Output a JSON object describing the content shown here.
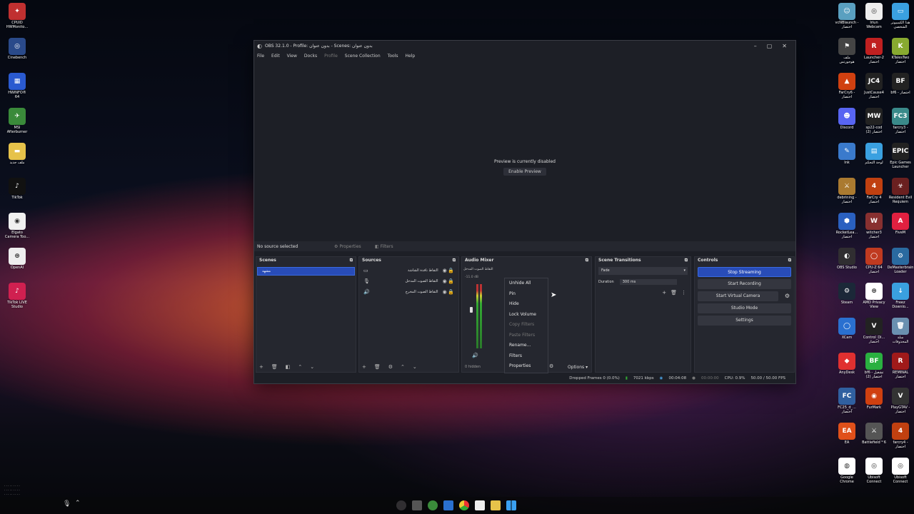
{
  "desktop_left": [
    {
      "label": "CPUID\nHWMonito...",
      "color": "#c03030",
      "glyph": "✦",
      "icon": "hwmonitor-icon"
    },
    {
      "label": "Cinebench",
      "color": "#2a4a8a",
      "glyph": "◎",
      "icon": "cinebench-icon"
    },
    {
      "label": "HWiNFO®\n64",
      "color": "#2a5ad0",
      "glyph": "▦",
      "icon": "hwinfo-icon"
    },
    {
      "label": "MSI\nAfterburner",
      "color": "#3a8a3a",
      "glyph": "✈",
      "icon": "afterburner-icon"
    },
    {
      "label": "ملف جديد",
      "color": "#e6c24a",
      "glyph": "▬",
      "icon": "folder-icon"
    },
    {
      "label": "TikTok",
      "color": "#111111",
      "glyph": "♪",
      "icon": "tiktok-icon"
    },
    {
      "label": "Elgato\nCamera Too...",
      "color": "#f0f0f0",
      "glyph": "◉",
      "icon": "elgato-icon"
    },
    {
      "label": "OpenAI",
      "color": "#eeeeee",
      "glyph": "⊛",
      "icon": "openai-icon"
    },
    {
      "label": "TikTok LIVE\nStudio",
      "color": "#d02050",
      "glyph": "♪",
      "icon": "tiktok-live-icon"
    }
  ],
  "desktop_right_col1": [
    {
      "label": "vcNBlaunch -\nاختصار",
      "color": "#5aa0c0",
      "glyph": "☺",
      "icon": "launcher-icon"
    },
    {
      "label": "ملف\nهوجورتس",
      "color": "#444444",
      "glyph": "⚑",
      "icon": "hogwarts-icon"
    },
    {
      "label": "FarCry6 -\nاختصار",
      "color": "#d04010",
      "glyph": "▲",
      "icon": "farcry6-icon"
    },
    {
      "label": "Discord",
      "color": "#5865f2",
      "glyph": "☻",
      "icon": "discord-icon"
    },
    {
      "label": "Ink",
      "color": "#3a7acc",
      "glyph": "✎",
      "icon": "ink-icon"
    },
    {
      "label": "debrining -\nاختصار",
      "color": "#aa7a30",
      "glyph": "⚔",
      "icon": "game-icon"
    },
    {
      "label": "RocketLea...\nاختصار",
      "color": "#2a60c0",
      "glyph": "⬢",
      "icon": "rocketleague-icon"
    },
    {
      "label": "OBS Studio",
      "color": "#302e31",
      "glyph": "◐",
      "icon": "obs-icon"
    },
    {
      "label": "Steam",
      "color": "#1b2838",
      "glyph": "⚙",
      "icon": "steam-icon"
    },
    {
      "label": "XCam",
      "color": "#2a70d0",
      "glyph": "◯",
      "icon": "xcam-icon"
    },
    {
      "label": "AnyDesk",
      "color": "#e03030",
      "glyph": "◆",
      "icon": "anydesk-icon"
    },
    {
      "label": "FC25_d_...\nاختصار",
      "color": "#3060a0",
      "glyph": "FC",
      "icon": "fc25-icon"
    },
    {
      "label": "EA",
      "color": "#e0501a",
      "glyph": "EA",
      "icon": "ea-icon"
    },
    {
      "label": "Google\nChrome",
      "color": "#ffffff",
      "glyph": "◍",
      "icon": "chrome-icon"
    }
  ],
  "desktop_right_col2": [
    {
      "label": "Iriun\nWebcam",
      "color": "#eeeeee",
      "glyph": "◎",
      "icon": "iriun-icon"
    },
    {
      "label": "Launcher-2\nاختصار",
      "color": "#c02020",
      "glyph": "R",
      "icon": "launcher2-icon"
    },
    {
      "label": "JustCause4\nاختصار",
      "color": "#222222",
      "glyph": "JC4",
      "icon": "jc4-icon"
    },
    {
      "label": "sp22-cod\nاختصار (2)",
      "color": "#222222",
      "glyph": "MW",
      "icon": "cod-icon"
    },
    {
      "label": "لوحة التحكم",
      "color": "#3aa0e0",
      "glyph": "▤",
      "icon": "control-panel-icon"
    },
    {
      "label": "FarCry 4\nاختصار",
      "color": "#c04010",
      "glyph": "4",
      "icon": "farcry4-icon"
    },
    {
      "label": "witcher3\nاختصار",
      "color": "#883030",
      "glyph": "W",
      "icon": "witcher-icon"
    },
    {
      "label": "CPU-Z 64\nاختصار",
      "color": "#c03a20",
      "glyph": "◯",
      "icon": "cpuz-icon"
    },
    {
      "label": "AMD Privacy\nView",
      "color": "#ffffff",
      "glyph": "⊛",
      "icon": "amd-icon"
    },
    {
      "label": "Control_Di...\nاختصار",
      "color": "#222222",
      "glyph": "V",
      "icon": "control-icon"
    },
    {
      "label": "bf6 - تشغيل\nاختصار (2)",
      "color": "#2ab040",
      "glyph": "BF",
      "icon": "bf6-icon"
    },
    {
      "label": "FurMark",
      "color": "#d04010",
      "glyph": "◉",
      "icon": "furmark-icon"
    },
    {
      "label": "Battlefield™6",
      "color": "#555555",
      "glyph": "⚔",
      "icon": "battlefield-icon"
    },
    {
      "label": "Ubisoft\nConnect",
      "color": "#ffffff",
      "glyph": "◎",
      "icon": "ubisoft-icon"
    }
  ],
  "desktop_right_col3": [
    {
      "label": "هذا الكمبيوتر\nالشخصي",
      "color": "#3aa0e0",
      "glyph": "▭",
      "icon": "this-pc-icon"
    },
    {
      "label": "KTalesTwo\nاختصار",
      "color": "#88aa30",
      "glyph": "K",
      "icon": "ktales-icon"
    },
    {
      "label": "bf6 - اختصار",
      "color": "#222222",
      "glyph": "BF",
      "icon": "bf6-shortcut-icon"
    },
    {
      "label": "farcry3 -\nاختصار",
      "color": "#3a8a8a",
      "glyph": "FC3",
      "icon": "farcry3-icon"
    },
    {
      "label": "Epic Games\nLauncher",
      "color": "#222222",
      "glyph": "EPIC",
      "icon": "epic-icon"
    },
    {
      "label": "Resident Evil\nRequiem",
      "color": "#6a2020",
      "glyph": "☣",
      "icon": "re-icon"
    },
    {
      "label": "FiveM",
      "color": "#e02040",
      "glyph": "A",
      "icon": "fivem-icon"
    },
    {
      "label": "DeMasterbrain\nLoader",
      "color": "#2a6aa0",
      "glyph": "⚙",
      "icon": "loader-icon"
    },
    {
      "label": "Freez\nDownlo...",
      "color": "#3aa0e0",
      "glyph": "↓",
      "icon": "download-icon"
    },
    {
      "label": "سلة\nالمحذوفات",
      "color": "#6a90b0",
      "glyph": "🗑",
      "icon": "recycle-bin-icon"
    },
    {
      "label": "REMINAL\nاختصار",
      "color": "#a01a1a",
      "glyph": "R",
      "icon": "reminal-icon"
    },
    {
      "label": "PlayGTAV -\nاختصار",
      "color": "#333333",
      "glyph": "V",
      "icon": "gtav-icon"
    },
    {
      "label": "farcry4 -\nاختصار",
      "color": "#c04010",
      "glyph": "4",
      "icon": "farcry4-shortcut-icon"
    },
    {
      "label": "Ubisoft\nConnect",
      "color": "#ffffff",
      "glyph": "◎",
      "icon": "ubisoft2-icon"
    }
  ],
  "obs": {
    "title": "OBS 32.1.0 - Profile: بدون عنوان - Scenes: بدون عنوان",
    "menu": [
      "File",
      "Edit",
      "View",
      "Docks",
      "Profile",
      "Scene Collection",
      "Tools",
      "Help"
    ],
    "preview_msg": "Preview is currently disabled",
    "enable_preview": "Enable Preview",
    "no_source": "No source selected",
    "properties": "Properties",
    "filters": "Filters",
    "scenes_title": "Scenes",
    "scene_item": "مشهد",
    "sources_title": "Sources",
    "sources": [
      "التقاط نافذة الشاشة",
      "التقاط الصوت المدخل",
      "التقاط الصوت المخرج"
    ],
    "mixer_title": "Audio Mixer",
    "mixer_channel": "التقاط الصوت المدخل",
    "mixer_db": "-11.0 dB",
    "hidden": "0 hidden",
    "options": "Options",
    "transitions_title": "Scene Transitions",
    "transition": "Fade",
    "duration_label": "Duration",
    "duration_value": "300 ms",
    "controls_title": "Controls",
    "controls": [
      "Stop Streaming",
      "Start Recording",
      "Start Virtual Camera",
      "Studio Mode",
      "Settings"
    ],
    "context_menu": [
      "Unhide All",
      "Pin",
      "Hide",
      "Lock Volume",
      "Copy Filters",
      "Paste Filters",
      "Rename...",
      "Filters",
      "Properties"
    ],
    "status": {
      "dropped": "Dropped Frames 0 (0.0%)",
      "kbps": "7021 kbps",
      "stream_time": "00:04:08",
      "rec_time": "00:00:00",
      "cpu": "CPU: 0.9%",
      "fps": "50.00 / 50.00 FPS"
    }
  },
  "colors": {
    "accent": "#284cb8",
    "panel": "#25272f",
    "window": "#1d1f26"
  }
}
